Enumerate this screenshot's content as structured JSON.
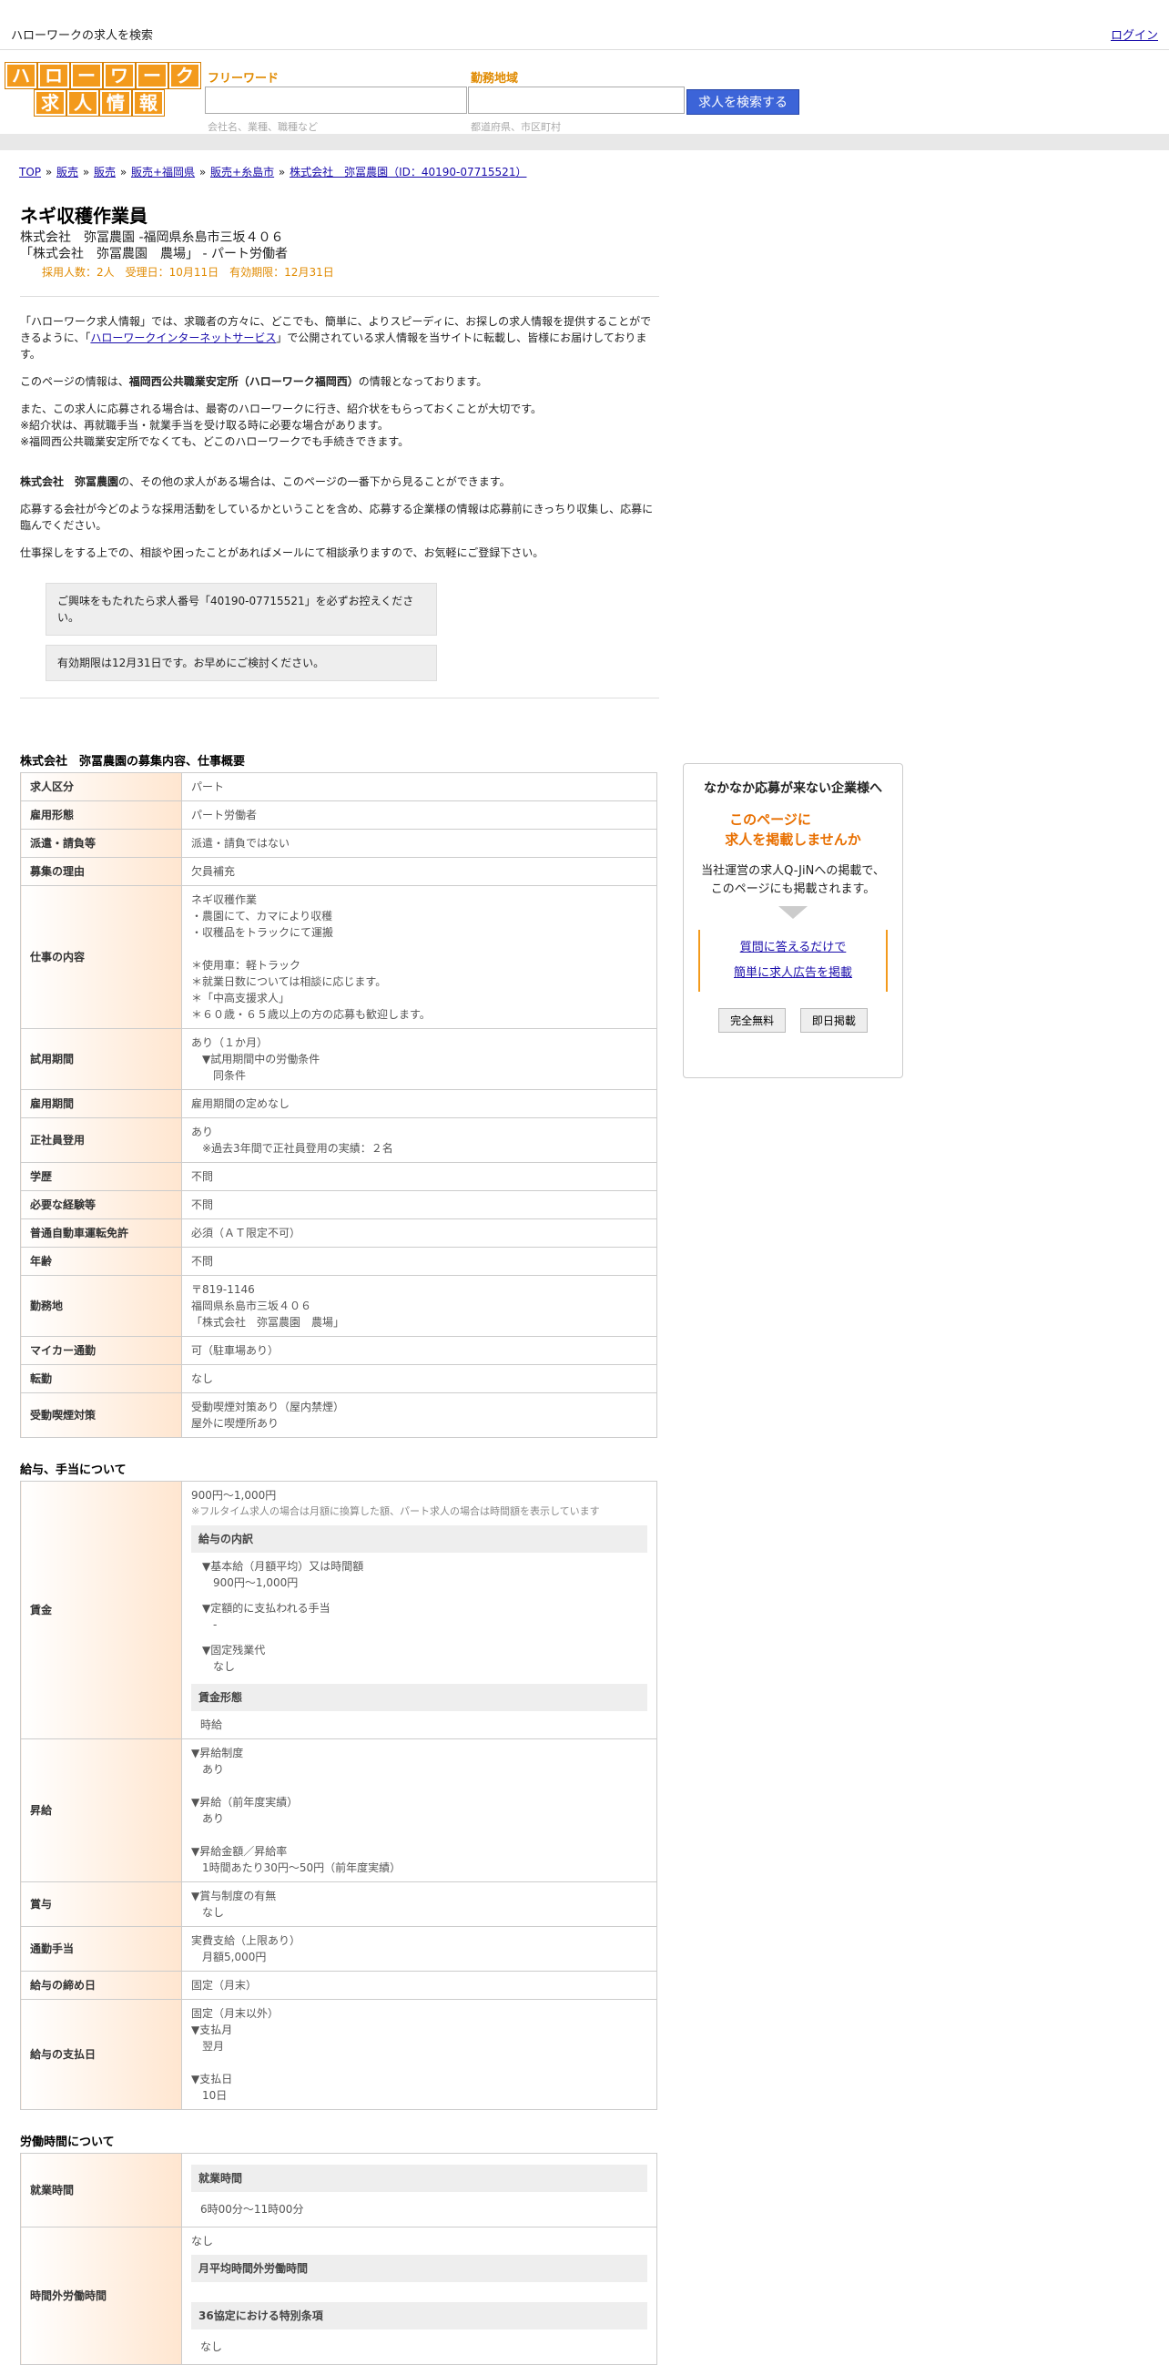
{
  "header": {
    "site_desc": "ハローワークの求人を検索",
    "login": "ログイン"
  },
  "search": {
    "logo_row1": [
      "ハ",
      "ロ",
      "ー",
      "ワ",
      "ー",
      "ク"
    ],
    "logo_row2": [
      "求",
      "人",
      "情",
      "報"
    ],
    "freeword_label": "フリーワード",
    "freeword_hint": "会社名、業種、職種など",
    "area_label": "勤務地域",
    "area_hint": "都道府県、市区町村",
    "button": "求人を検索する"
  },
  "breadcrumb": [
    "TOP",
    "販売",
    "販売",
    "販売+福岡県",
    "販売+糸島市",
    "株式会社　弥冨農園（ID：40190-07715521）"
  ],
  "job": {
    "title": "ネギ収穫作業員",
    "company_line": "株式会社　弥冨農園 -福岡県糸島市三坂４０６",
    "workplace_line": "「株式会社　弥冨農園　農場」 - パート労働者",
    "stats": "採用人数：2人　受理日：10月11日　有効期限：12月31日"
  },
  "intro": {
    "p1_a": "「ハローワーク求人情報」では、求職者の方々に、どこでも、簡単に、よりスピーディに、お探しの求人情報を提供することができるように、「",
    "p1_link": "ハローワークインターネットサービス",
    "p1_b": "」で公開されている求人情報を当サイトに転載し、皆様にお届けしております。",
    "p2_a": "このページの情報は、",
    "p2_bold": "福岡西公共職業安定所（ハローワーク福岡西）",
    "p2_b": "の情報となっております。",
    "p3_1": "また、この求人に応募される場合は、最寄のハローワークに行き、紹介状をもらっておくことが大切です。",
    "p3_2": "※紹介状は、再就職手当・就業手当を受け取る時に必要な場合があります。",
    "p3_3": "※福岡西公共職業安定所でなくても、どこのハローワークでも手続きできます。",
    "p4_bold": "株式会社　弥冨農園",
    "p4_rest": "の、その他の求人がある場合は、このページの一番下から見ることができます。",
    "p5": "応募する会社が今どのような採用活動をしているかということを含め、応募する企業様の情報は応募前にきっちり収集し、応募に臨んでください。",
    "p6": "仕事探しをする上での、相談や困ったことがあればメールにて相談承りますので、お気軽にご登録下さい。",
    "notice1": "ご興味をもたれたら求人番号「40190-07715521」を必ずお控えください。",
    "notice2": "有効期限は12月31日です。お早めにご検討ください。"
  },
  "section1": {
    "title": "株式会社　弥冨農園の募集内容、仕事概要",
    "rows": [
      {
        "h": "求人区分",
        "v": [
          "パート"
        ]
      },
      {
        "h": "雇用形態",
        "v": [
          "パート労働者"
        ]
      },
      {
        "h": "派遣・請負等",
        "v": [
          "派遣・請負ではない"
        ]
      },
      {
        "h": "募集の理由",
        "v": [
          "欠員補充"
        ]
      },
      {
        "h": "仕事の内容",
        "v": [
          "ネギ収穫作業",
          "・農園にて、カマにより収穫",
          "・収穫品をトラックにて運搬",
          "",
          "＊使用車：軽トラック",
          "＊就業日数については相談に応じます。",
          "＊「中高支援求人」",
          "＊６０歳・６５歳以上の方の応募も歓迎します。"
        ]
      },
      {
        "h": "試用期間",
        "v": [
          "あり（１か月）",
          "　▼試用期間中の労働条件",
          "　　同条件"
        ]
      },
      {
        "h": "雇用期間",
        "v": [
          "雇用期間の定めなし"
        ]
      },
      {
        "h": "正社員登用",
        "v": [
          "あり",
          "　※過去3年間で正社員登用の実績：２名"
        ]
      },
      {
        "h": "学歴",
        "v": [
          "不問"
        ]
      },
      {
        "h": "必要な経験等",
        "v": [
          "不問"
        ]
      },
      {
        "h": "普通自動車運転免許",
        "v": [
          "必須（ＡＴ限定不可）"
        ]
      },
      {
        "h": "年齢",
        "v": [
          "不問"
        ]
      },
      {
        "h": "勤務地",
        "v": [
          "〒819-1146",
          "福岡県糸島市三坂４０６",
          "「株式会社　弥冨農園　農場」"
        ]
      },
      {
        "h": "マイカー通勤",
        "v": [
          "可（駐車場あり）"
        ]
      },
      {
        "h": "転勤",
        "v": [
          "なし"
        ]
      },
      {
        "h": "受動喫煙対策",
        "v": [
          "受動喫煙対策あり（屋内禁煙）",
          "屋外に喫煙所あり"
        ]
      }
    ]
  },
  "section2": {
    "title": "給与、手当について",
    "wage_label": "賃金",
    "wage_range": "900円〜1,000円",
    "wage_note": "※フルタイム求人の場合は月額に換算した額、パート求人の場合は時間額を表示しています",
    "wage_breakdown": "給与の内訳",
    "base_label": "▼基本給（月額平均）又は時間額",
    "base_value": "900円〜1,000円",
    "fixed_allow_label": "▼定額的に支払われる手当",
    "fixed_allow_value": "-",
    "fixed_ot_label": "▼固定残業代",
    "fixed_ot_value": "なし",
    "wage_form_head": "賃金形態",
    "wage_form": "時給",
    "raise_label": "昇給",
    "raise": [
      "▼昇給制度",
      "　あり",
      "",
      "▼昇給（前年度実績）",
      "　あり",
      "",
      "▼昇給金額／昇給率",
      "　1時間あたり30円〜50円（前年度実績）"
    ],
    "bonus_label": "賞与",
    "bonus": [
      "▼賞与制度の有無",
      "　なし"
    ],
    "commute_label": "通勤手当",
    "commute": [
      "実費支給（上限あり）",
      "　月額5,000円"
    ],
    "closing_label": "給与の締め日",
    "closing": [
      "固定（月末）"
    ],
    "payday_label": "給与の支払日",
    "payday": [
      "固定（月末以外）",
      "▼支払月",
      "　翌月",
      "",
      "▼支払日",
      "　10日"
    ]
  },
  "section3": {
    "title": "労働時間について",
    "hours_label": "就業時間",
    "hours_head": "就業時間",
    "hours": "6時00分〜11時00分",
    "ot_label": "時間外労働時間",
    "ot_value": "なし",
    "ot_head1": "月平均時間外労働時間",
    "ot_head2": "36協定における特別条項",
    "ot_special": "なし"
  },
  "sidebar": {
    "title": "なかなか応募が来ない企業様へ",
    "orange1": "このページに",
    "orange2": "求人を掲載しませんか",
    "desc1": "当社運営の求人Q-JiNへの掲載で、",
    "desc2": "このページにも掲載されます。",
    "link1": "質問に答えるだけで",
    "link2": "簡単に求人広告を掲載",
    "btn1": "完全無料",
    "btn2": "即日掲載"
  }
}
